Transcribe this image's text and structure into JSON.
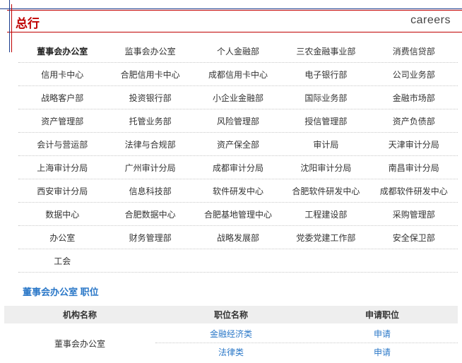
{
  "header": {
    "title": "总行",
    "subtitle": "careers"
  },
  "departments": [
    [
      "董事会办公室",
      "监事会办公室",
      "个人金融部",
      "三农金融事业部",
      "消费信贷部"
    ],
    [
      "信用卡中心",
      "合肥信用卡中心",
      "成都信用卡中心",
      "电子银行部",
      "公司业务部"
    ],
    [
      "战略客户部",
      "投资银行部",
      "小企业金融部",
      "国际业务部",
      "金融市场部"
    ],
    [
      "资产管理部",
      "托管业务部",
      "风险管理部",
      "授信管理部",
      "资产负债部"
    ],
    [
      "会计与营运部",
      "法律与合规部",
      "资产保全部",
      "审计局",
      "天津审计分局"
    ],
    [
      "上海审计分局",
      "广州审计分局",
      "成都审计分局",
      "沈阳审计分局",
      "南昌审计分局"
    ],
    [
      "西安审计分局",
      "信息科技部",
      "软件研发中心",
      "合肥软件研发中心",
      "成都软件研发中心"
    ],
    [
      "数据中心",
      "合肥数据中心",
      "合肥基地管理中心",
      "工程建设部",
      "采购管理部"
    ],
    [
      "办公室",
      "财务管理部",
      "战略发展部",
      "党委党建工作部",
      "安全保卫部"
    ],
    [
      "工会"
    ]
  ],
  "selected_department": "董事会办公室",
  "positions_section": {
    "title": "董事会办公室 职位"
  },
  "table": {
    "headers": [
      "机构名称",
      "职位名称",
      "申请职位"
    ],
    "org_name": "董事会办公室",
    "rows": [
      {
        "position": "金融经济类",
        "apply": "申请"
      },
      {
        "position": "法律类",
        "apply": "申请"
      }
    ]
  },
  "colors": {
    "accent_red": "#c00000",
    "accent_blue": "#1a3d8f",
    "link_blue": "#2b78c8"
  }
}
